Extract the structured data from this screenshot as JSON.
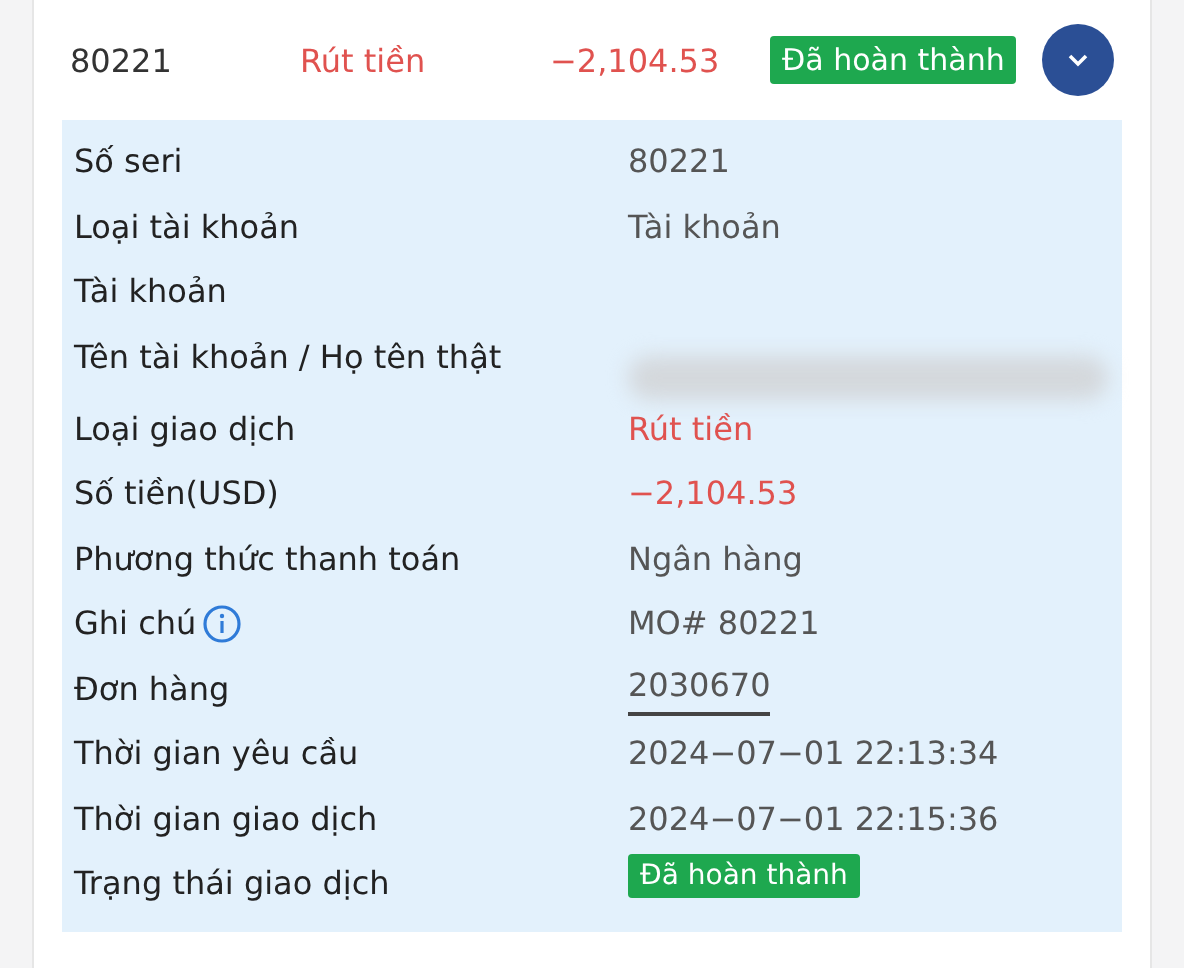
{
  "summary": {
    "serial": "80221",
    "type": "Rút tiền",
    "amount": "−2,104.53",
    "status": "Đã hoàn thành",
    "expanded": true
  },
  "details": [
    {
      "label": "Số seri",
      "kind": "text",
      "value": "80221"
    },
    {
      "label": "Loại tài khoản",
      "kind": "text",
      "value": "Tài khoản"
    },
    {
      "label": "Tài khoản",
      "kind": "empty"
    },
    {
      "label": "Tên tài khoản / Họ tên thật",
      "kind": "redacted"
    },
    {
      "label": "Loại giao dịch",
      "kind": "negative",
      "value": "Rút tiền"
    },
    {
      "label": "Số tiền(USD)",
      "kind": "negative",
      "value": "−2,104.53"
    },
    {
      "label": "Phương thức thanh toán",
      "kind": "text",
      "value": "Ngân hàng"
    },
    {
      "label": "Ghi chú",
      "kind": "text",
      "value": "MO# 80221",
      "info": true
    },
    {
      "label": "Đơn hàng",
      "kind": "link",
      "value": "2030670"
    },
    {
      "label": "Thời gian yêu cầu",
      "kind": "text",
      "value": "2024−07−01 22:13:34"
    },
    {
      "label": "Thời gian giao dịch",
      "kind": "text",
      "value": "2024−07−01 22:15:36"
    },
    {
      "label": "Trạng thái giao dịch",
      "kind": "badge",
      "value": "Đã hoàn thành"
    }
  ]
}
